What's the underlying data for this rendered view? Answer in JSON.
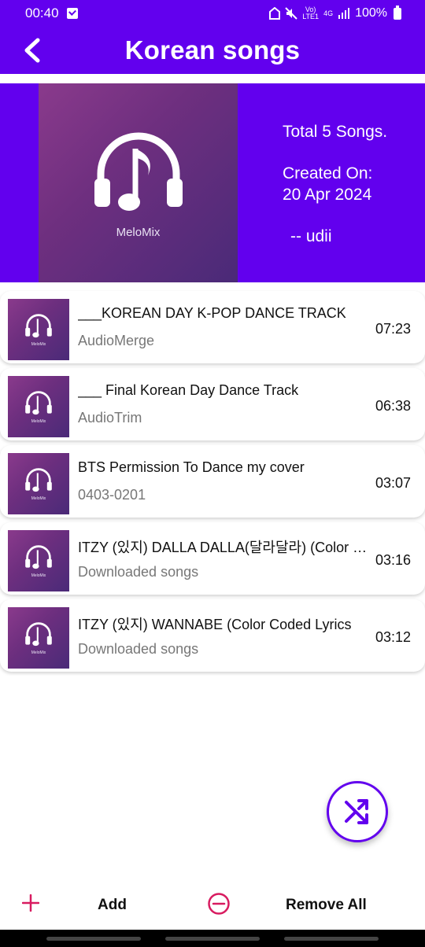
{
  "status_bar": {
    "time": "00:40",
    "network_top": "Vo)",
    "network_bottom": "LTE1",
    "data_type": "4G",
    "battery": "100%"
  },
  "app_bar": {
    "title": "Korean songs",
    "back_icon": "chevron-left-icon"
  },
  "playlist": {
    "cover_brand": "MeloMix",
    "total": "Total 5 Songs.",
    "created_label": "Created On:",
    "created_date": "20 Apr 2024",
    "author": "-- udii"
  },
  "songs": [
    {
      "title": "___KOREAN DAY K-POP DANCE TRACK",
      "folder": "AudioMerge",
      "duration": "07:23"
    },
    {
      "title": "___ Final Korean Day Dance Track",
      "folder": "AudioTrim",
      "duration": "06:38"
    },
    {
      "title": "BTS  Permission To Dance my cover",
      "folder": "0403-0201",
      "duration": "03:07"
    },
    {
      "title": "ITZY (있지) DALLA DALLA(달라달라) (Color Coded Lyrics",
      "folder": "Downloaded songs",
      "duration": "03:16"
    },
    {
      "title": "ITZY (있지) WANNABE (Color Coded Lyrics",
      "folder": "Downloaded songs",
      "duration": "03:12"
    }
  ],
  "thumb_brand": "MeloMix",
  "fab": {
    "icon": "shuffle-icon"
  },
  "bottom_bar": {
    "add_label": "Add",
    "remove_label": "Remove All"
  },
  "colors": {
    "primary": "#6200ee",
    "accent_red": "#d81b60"
  }
}
